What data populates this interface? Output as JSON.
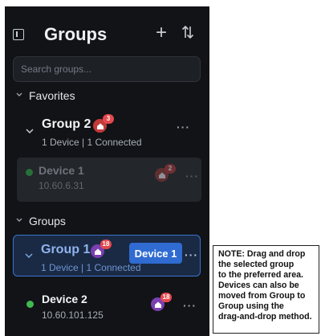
{
  "header": {
    "title": "Groups"
  },
  "search": {
    "placeholder": "Search groups..."
  },
  "favorites": {
    "label": "Favorites",
    "group": {
      "name": "Group 2",
      "badge_count": "3",
      "subtitle": "1 Device | 1 Connected"
    },
    "dragged_device": {
      "name": "Device 1",
      "ip": "10.60.6.31",
      "badge_count": "2"
    }
  },
  "groups": {
    "label": "Groups",
    "selected_group": {
      "name": "Group 1",
      "badge_count": "18",
      "subtitle": "1 Device | 1 Connected"
    },
    "drag_chip_label": "Device 1",
    "device": {
      "name": "Device 2",
      "ip": "10.60.101.125",
      "badge_count": "18"
    }
  },
  "note": {
    "lines": [
      "NOTE: Drag and drop",
      "the selected group",
      "to the preferred area.",
      "Devices can also be",
      "moved from Group to",
      "Group using the",
      "drag-and-drop method."
    ]
  },
  "colors": {
    "panel_bg": "#111316",
    "accent_blue": "#2f6bd1",
    "online_green": "#3fb950",
    "badge_red": "#e5484d",
    "device_icon_purple": "#7a3fb0"
  },
  "icons": {
    "sidebar": "sidebar-toggle-icon",
    "add": "plus-icon",
    "sort": "sort-arrows-icon",
    "collapse": "chevron-down-icon",
    "home": "home-icon",
    "more": "more-dots-icon"
  }
}
